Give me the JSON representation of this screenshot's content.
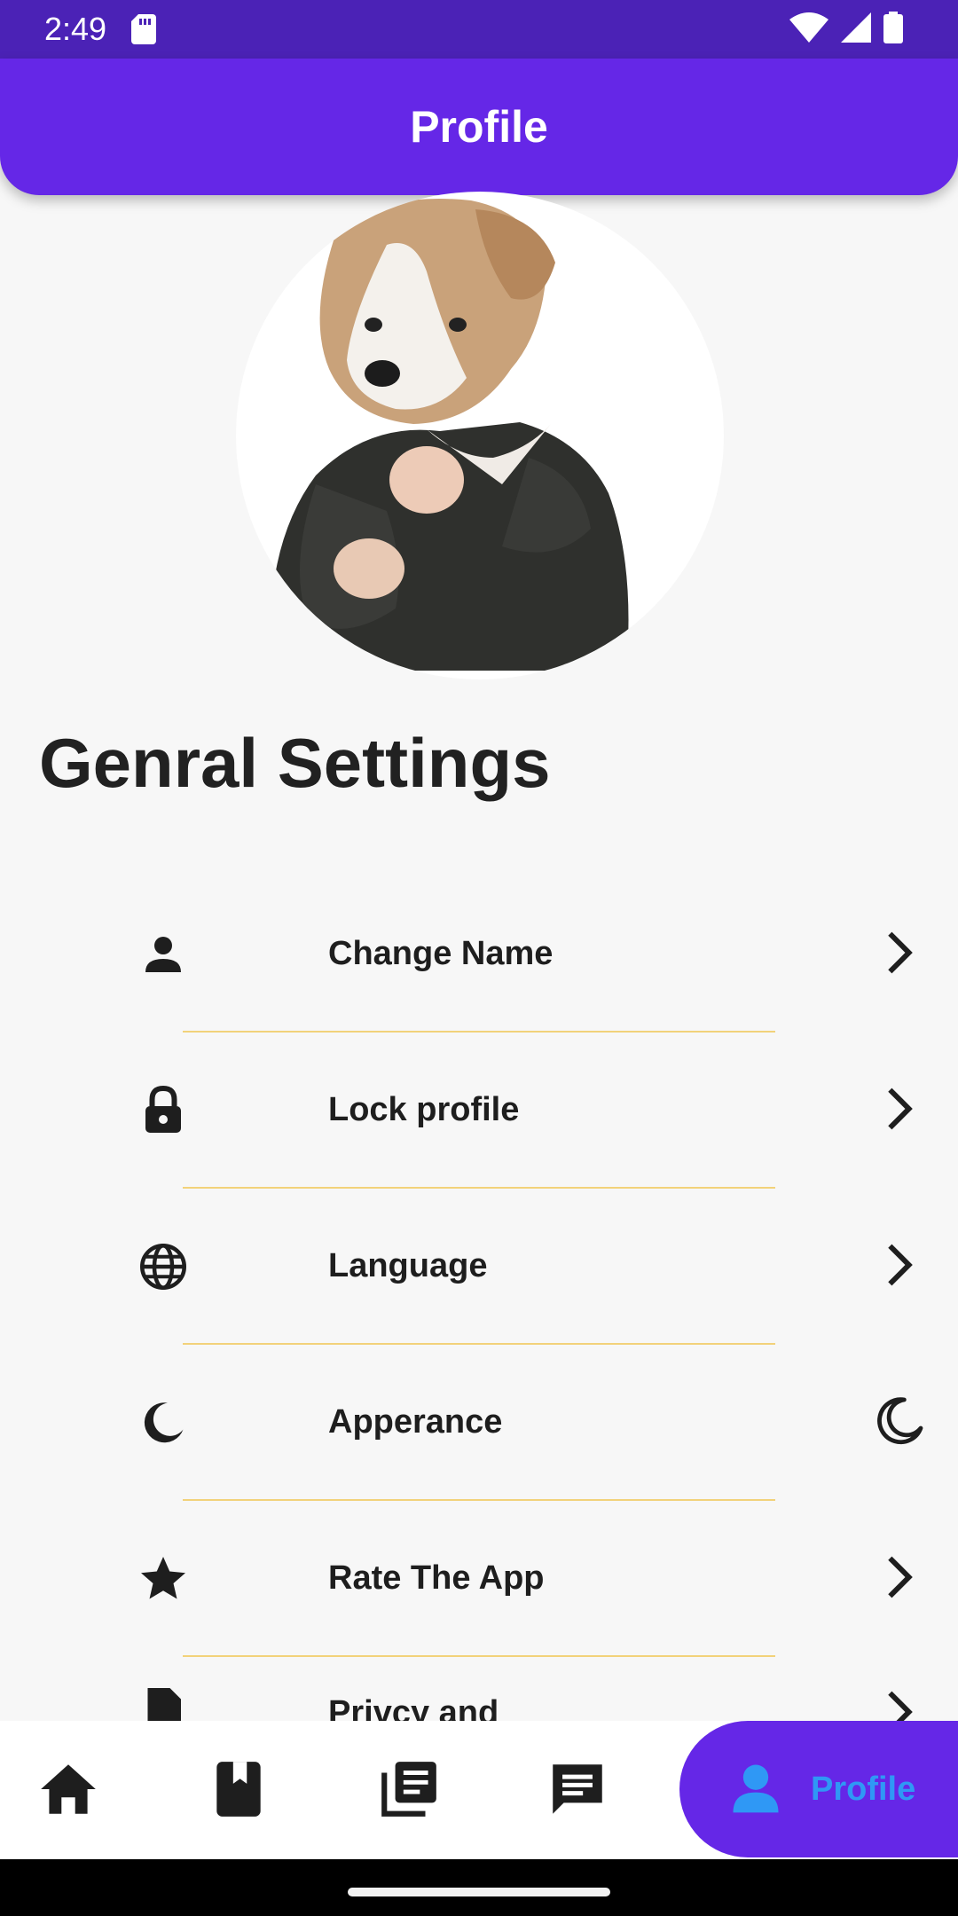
{
  "status_bar": {
    "time": "2:49",
    "icons": [
      "sd-card-icon",
      "wifi-icon",
      "signal-icon",
      "battery-icon"
    ]
  },
  "app_bar": {
    "title": "Profile"
  },
  "avatar": {
    "image": "dog-in-suit-avatar"
  },
  "section": {
    "title": "Genral Settings"
  },
  "settings": [
    {
      "icon": "person-icon",
      "label": "Change Name",
      "trailing": "chevron-right-icon"
    },
    {
      "icon": "lock-icon",
      "label": "Lock profile",
      "trailing": "chevron-right-icon"
    },
    {
      "icon": "globe-icon",
      "label": "Language",
      "trailing": "chevron-right-icon"
    },
    {
      "icon": "moon-icon",
      "label": "Apperance",
      "trailing": "moon-outline-icon"
    },
    {
      "icon": "star-icon",
      "label": "Rate The App",
      "trailing": "chevron-right-icon"
    },
    {
      "icon": "document-icon",
      "label": "Privcy and",
      "trailing": "chevron-right-icon"
    }
  ],
  "bottom_nav": {
    "items": [
      "home-icon",
      "book-icon",
      "library-icon",
      "chat-icon"
    ],
    "active": {
      "icon": "person-icon",
      "label": "Profile"
    }
  },
  "colors": {
    "status_bar": "#4b22b6",
    "primary": "#6527e7",
    "active_label": "#2f98f5",
    "divider": "#f2d27a",
    "background": "#f7f7f7"
  }
}
